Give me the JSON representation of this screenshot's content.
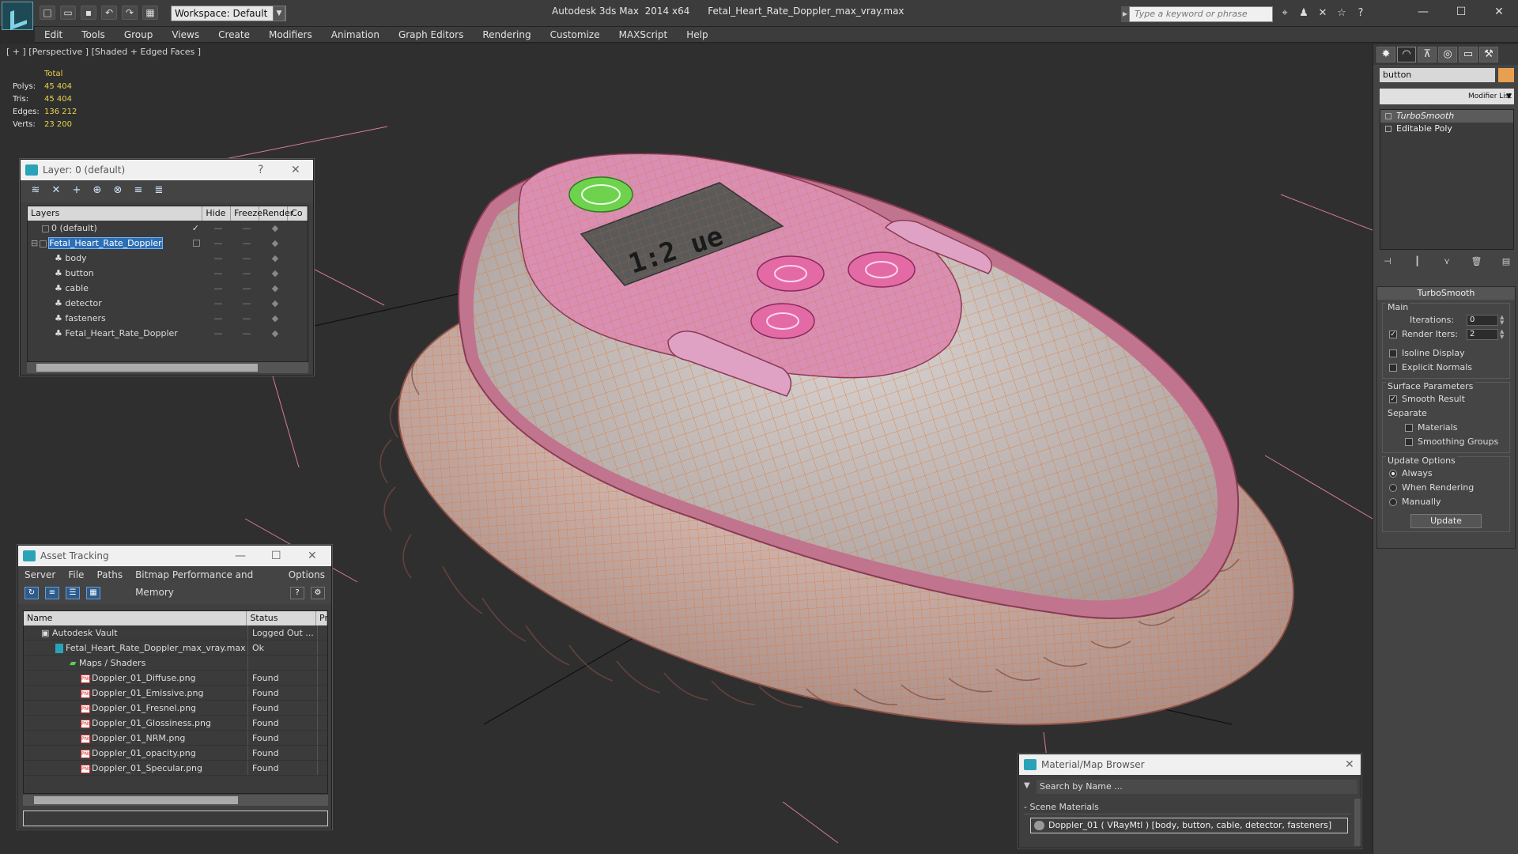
{
  "app": {
    "title": "Autodesk 3ds Max  2014 x64      Fetal_Heart_Rate_Doppler_max_vray.max",
    "workspace": "Workspace: Default",
    "search_placeholder": "Type a keyword or phrase"
  },
  "menu": [
    "Edit",
    "Tools",
    "Group",
    "Views",
    "Create",
    "Modifiers",
    "Animation",
    "Graph Editors",
    "Rendering",
    "Customize",
    "MAXScript",
    "Help"
  ],
  "viewport": {
    "label": "[ + ] [Perspective ] [Shaded + Edged Faces ]",
    "stats_header": "Total",
    "stats": [
      {
        "k": "Polys:",
        "v": "45 404"
      },
      {
        "k": "Tris:",
        "v": "45 404"
      },
      {
        "k": "Edges:",
        "v": "136 212"
      },
      {
        "k": "Verts:",
        "v": "23 200"
      }
    ],
    "display_digits": "1:2 ue"
  },
  "layer_panel": {
    "title": "Layer: 0 (default)",
    "help": "?",
    "close": "✕",
    "columns": [
      "Layers",
      "Hide",
      "Freeze",
      "Render",
      "Co"
    ],
    "rows": [
      {
        "name": "0 (default)"
      },
      {
        "name": "Fetal_Heart_Rate_Doppler"
      },
      {
        "name": "body"
      },
      {
        "name": "button"
      },
      {
        "name": "cable"
      },
      {
        "name": "detector"
      },
      {
        "name": "fasteners"
      },
      {
        "name": "Fetal_Heart_Rate_Doppler"
      }
    ]
  },
  "asset_panel": {
    "title": "Asset Tracking",
    "menu": [
      "Server",
      "File",
      "Paths",
      "Bitmap Performance and Memory",
      "Options"
    ],
    "columns": [
      "Name",
      "Status",
      "Pr"
    ],
    "rows": [
      {
        "name": "Autodesk Vault",
        "status": "Logged Out ..."
      },
      {
        "name": "Fetal_Heart_Rate_Doppler_max_vray.max",
        "status": "Ok"
      },
      {
        "name": "Maps / Shaders",
        "status": ""
      },
      {
        "name": "Doppler_01_Diffuse.png",
        "status": "Found"
      },
      {
        "name": "Doppler_01_Emissive.png",
        "status": "Found"
      },
      {
        "name": "Doppler_01_Fresnel.png",
        "status": "Found"
      },
      {
        "name": "Doppler_01_Glossiness.png",
        "status": "Found"
      },
      {
        "name": "Doppler_01_NRM.png",
        "status": "Found"
      },
      {
        "name": "Doppler_01_opacity.png",
        "status": "Found"
      },
      {
        "name": "Doppler_01_Specular.png",
        "status": "Found"
      }
    ]
  },
  "mat_panel": {
    "title": "Material/Map Browser",
    "search": "Search by Name ...",
    "group": "- Scene Materials",
    "item": "Doppler_01  ( VRayMtl )  [body, button, cable, detector, fasteners]"
  },
  "command_panel": {
    "object_name": "button",
    "object_color": "#e8a050",
    "modifier_list": "Modifier List",
    "stack": [
      "TurboSmooth",
      "Editable Poly"
    ],
    "rollout_title": "TurboSmooth",
    "main_label": "Main",
    "iterations_label": "Iterations:",
    "iterations": "0",
    "render_iters_label": "Render Iters:",
    "render_iters": "2",
    "isoline": "Isoline Display",
    "explicit_normals": "Explicit Normals",
    "surface_label": "Surface Parameters",
    "smooth_result": "Smooth Result",
    "separate_label": "Separate",
    "materials": "Materials",
    "smoothing_groups": "Smoothing Groups",
    "update_label": "Update Options",
    "always": "Always",
    "when_rendering": "When Rendering",
    "manually": "Manually",
    "update_button": "Update"
  },
  "colors": {
    "accent": "#2aa3b8",
    "selection": "#2b6fb7",
    "wire": "#e36b1f",
    "stat_value": "#e9d54a"
  }
}
